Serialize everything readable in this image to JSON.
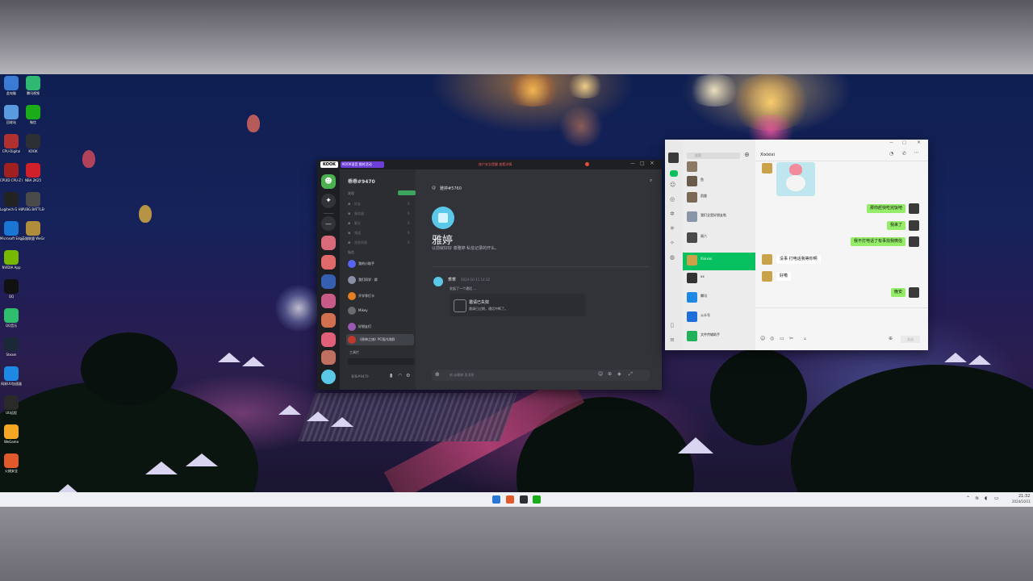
{
  "desktop": {
    "icons": [
      {
        "label": "此电脑",
        "color": "#3a7bd5"
      },
      {
        "label": "腾讯视频",
        "color": "#2eb872"
      },
      {
        "label": "回收站",
        "color": "#5a9be0"
      },
      {
        "label": "微信",
        "color": "#1aad19"
      },
      {
        "label": "CPU-Digital",
        "color": "#b03030"
      },
      {
        "label": "KOOK",
        "color": "#2c2f33"
      },
      {
        "label": "CPUID CPU-Z MSI",
        "color": "#a02020"
      },
      {
        "label": "NBA 2K25",
        "color": "#d0202a"
      },
      {
        "label": "Logitech G HUB",
        "color": "#222"
      },
      {
        "label": "PUBG BATTLEGR...",
        "color": "#4a4a4a"
      },
      {
        "label": "Microsoft Edge",
        "color": "#1976d2"
      },
      {
        "label": "英雄联盟 WeGame版",
        "color": "#b08d3a"
      },
      {
        "label": "NVIDIA App",
        "color": "#76b900"
      },
      {
        "label": "QQ",
        "color": "#111"
      },
      {
        "label": "QQ音乐",
        "color": "#2fbd6e"
      },
      {
        "label": "Steam",
        "color": "#1b2838"
      },
      {
        "label": "网易UU加速器",
        "color": "#1e88e5"
      },
      {
        "label": "UU远程",
        "color": "#2a2a2a"
      },
      {
        "label": "WeGame",
        "color": "#f5a623"
      },
      {
        "label": "火绒安全",
        "color": "#e05a2b"
      }
    ]
  },
  "kook": {
    "logo": "KOOK",
    "banner": "KOOK语音 限时活动",
    "notice": "账户安全提醒 查看详情",
    "user": "乖乖#9470",
    "section_label": "发现",
    "green_badge": "",
    "nav": [
      "好友",
      "服务器",
      "聊天",
      "频道",
      "消息列表"
    ],
    "dm_header": "私信",
    "dms": [
      {
        "name": "我的小助手",
        "tag": "",
        "color": "#5865f2"
      },
      {
        "name": "我们同学 · 群",
        "tag": "",
        "color": "#8a8fa6"
      },
      {
        "name": "开学季打卡",
        "tag": "",
        "color": "#e67e22"
      },
      {
        "name": "Mikey",
        "tag": "",
        "color": "#6b6b6b"
      },
      {
        "name": "好朋友们",
        "tag": "",
        "color": "#9b59b6"
      },
      {
        "name": "《原神之旅》PC版内测群",
        "tag": "",
        "color": "#c0392b"
      }
    ],
    "group_label": "工具栏",
    "bottom_user": "乖乖#9470",
    "channel_title": "雅婷#5760",
    "welcome_name": "雅婷",
    "welcome_sub": "以前就好好 谢雅婷 私信记录的开头。",
    "msg_author": "乖乖",
    "msg_time": "2024-10-11 14:32",
    "msg_text": "发起了一个通话 ...",
    "call_title": "邀请已失效",
    "call_sub": "邀请已过期，通话中断了。",
    "input_placeholder": "给 @雅婷 发消息"
  },
  "wechat": {
    "search_placeholder": "搜索",
    "title": "Xixixixi",
    "chats": [
      {
        "name": "",
        "color": "#8d7a66"
      },
      {
        "name": "鱼",
        "color": "#6b5b4a"
      },
      {
        "name": "凯旋",
        "color": "#7a6a55"
      },
      {
        "name": "我们全是好朋友啦",
        "color": "#8896a8"
      },
      {
        "name": "周六",
        "color": "#4a4a4a"
      },
      {
        "name": "Xixixixi",
        "color": "#c9a24a"
      },
      {
        "name": "xx",
        "color": "#333"
      },
      {
        "name": "腾讯",
        "color": "#1e88e5"
      },
      {
        "name": "公众号",
        "color": "#1e6fd9"
      },
      {
        "name": "文件传输助手",
        "color": "#20b15a"
      }
    ],
    "messages": [
      {
        "side": "right",
        "text": "那你赶快吃完饭吧"
      },
      {
        "side": "right",
        "text": "我来了"
      },
      {
        "side": "right",
        "text": "我不打电话了有事找我微信"
      },
      {
        "side": "left",
        "text": "没事 打电话我等你啊"
      },
      {
        "side": "left",
        "text": "好嘞"
      },
      {
        "side": "right",
        "text": "晚安"
      }
    ],
    "send_label": "发送"
  },
  "taskbar": {
    "time": "21:32",
    "date": "2024/10/11"
  }
}
